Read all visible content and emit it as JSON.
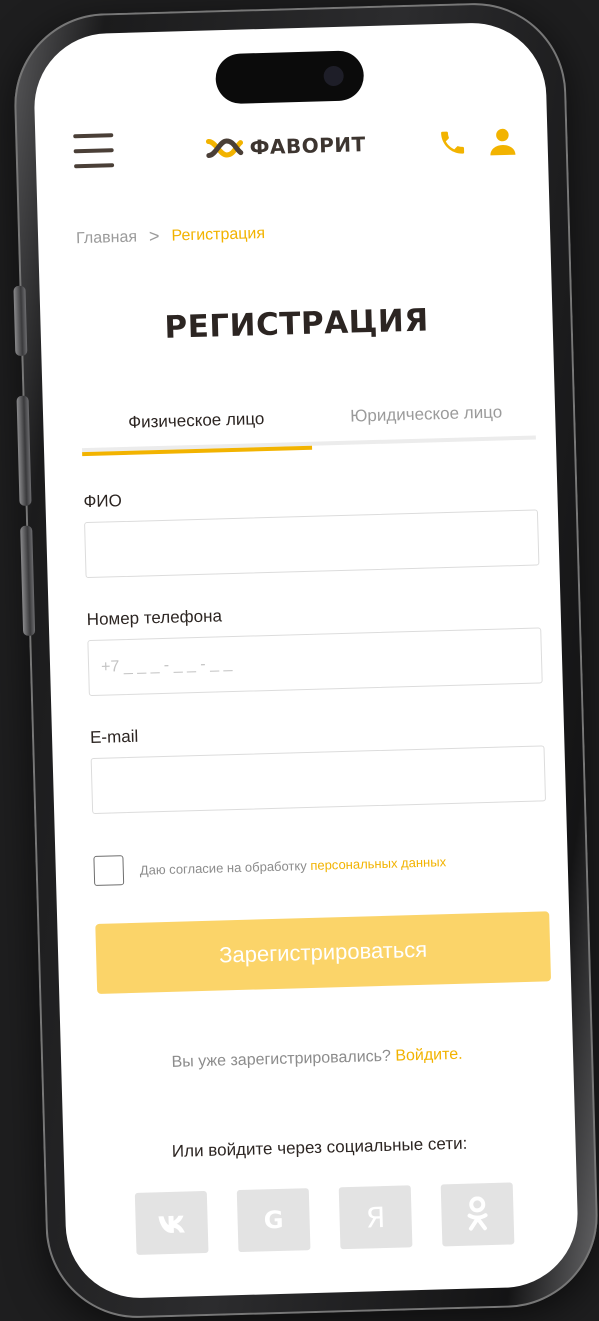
{
  "header": {
    "logo_text": "ФАВОРИТ",
    "icons": [
      "menu-icon",
      "logo-icon",
      "phone-icon",
      "user-icon"
    ],
    "accent_color": "#f2b300",
    "dark_color": "#4a3f37"
  },
  "breadcrumb": {
    "home": "Главная",
    "separator": ">",
    "current": "Регистрация"
  },
  "page_title": "РЕГИСТРАЦИЯ",
  "tabs": [
    {
      "label": "Физическое лицо",
      "active": true
    },
    {
      "label": "Юридическое лицо",
      "active": false
    }
  ],
  "form": {
    "name_label": "ФИО",
    "name_value": "",
    "phone_label": "Номер телефона",
    "phone_placeholder": "+7 _ _ _ - _ _ - _ _",
    "email_label": "E-mail",
    "email_value": "",
    "consent_text": "Даю согласие на обработку ",
    "consent_link": "персональных данных",
    "consent_checked": false,
    "submit_label": "Зарегистрироваться",
    "submit_color": "#fbd469"
  },
  "login": {
    "text": "Вы уже зарегистрировались? ",
    "link": "Войдите."
  },
  "social": {
    "title": "Или войдите через социальные сети:",
    "buttons": [
      {
        "label": "VK",
        "icon": "vk-icon"
      },
      {
        "label": "G",
        "icon": "google-icon"
      },
      {
        "label": "Я",
        "icon": "yandex-icon"
      },
      {
        "label": "OK",
        "icon": "odnoklassniki-icon"
      }
    ]
  }
}
